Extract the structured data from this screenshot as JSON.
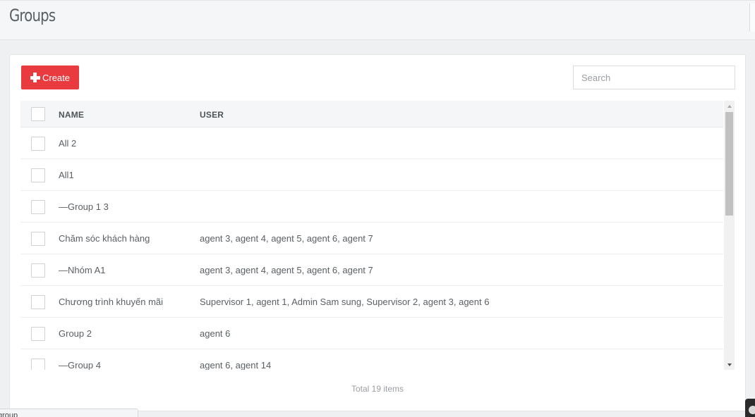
{
  "header": {
    "title": "Groups"
  },
  "toolbar": {
    "create_label": "Create",
    "search_placeholder": "Search",
    "search_value": ""
  },
  "table": {
    "columns": [
      "NAME",
      "USER"
    ],
    "rows": [
      {
        "name": "All 2",
        "user": ""
      },
      {
        "name": "All1",
        "user": ""
      },
      {
        "name": "—Group 1 3",
        "user": ""
      },
      {
        "name": "Chăm sóc khách hàng",
        "user": "agent 3, agent 4, agent 5, agent 6, agent 7"
      },
      {
        "name": "—Nhóm A1",
        "user": "agent 3, agent 4, agent 5, agent 6, agent 7"
      },
      {
        "name": "Chương trình khuyến mãi",
        "user": "Supervisor 1, agent 1, Admin Sam sung, Supervisor 2, agent 3, agent 6"
      },
      {
        "name": "Group 2",
        "user": "agent 6"
      },
      {
        "name": "—Group 4",
        "user": "agent 6, agent 14"
      }
    ]
  },
  "footer": {
    "total": "Total 19 items"
  },
  "status_bar": {
    "text": "group"
  },
  "colors": {
    "accent": "#e83a3f",
    "header_bg": "#f5f6f7",
    "page_bg": "#eef0f1"
  },
  "icons": {
    "create": "plus-icon",
    "scroll_up": "scroll-up-arrow-icon",
    "scroll_down": "scroll-down-arrow-icon"
  }
}
